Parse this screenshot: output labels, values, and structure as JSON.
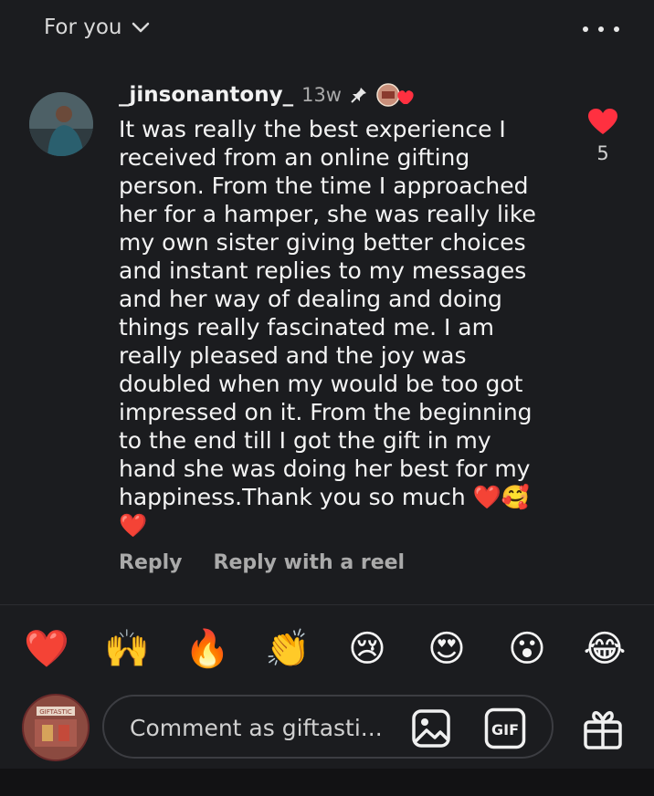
{
  "header": {
    "feed_label": "For you",
    "feed_chevron_icon": "chevron-down-icon",
    "more_icon": "more-horizontal-icon"
  },
  "comment": {
    "username": "_jinsonantony_",
    "age": "13w",
    "pinned_icon": "pin-icon",
    "creator_badge_icon": "liked-by-creator-icon",
    "text": "It was really the best experience I\nreceived from an online gifting\nperson. From the time I approached\nher for a hamper, she was really like\nmy own sister giving better choices\nand instant replies to my messages\nand her way of dealing and doing\nthings really fascinated me. I am\nreally pleased and the joy was\ndoubled when my would be too got\nimpressed on it. From the beginning\nto the end till I got the gift in my\nhand she was doing her best for my\nhappiness.Thank you so much ❤️🥰\n❤️",
    "like_icon": "heart-filled-icon",
    "like_count": "5",
    "reply_label": "Reply",
    "reply_reel_label": "Reply with a reel"
  },
  "quick_reactions": [
    "❤️",
    "🙌",
    "🔥",
    "👏",
    "😢",
    "😍",
    "😮",
    "😂"
  ],
  "composer": {
    "placeholder": "Comment as giftasti...",
    "avatar_text": "GIFTASTIC",
    "image_icon": "image-icon",
    "gif_label": "GIF",
    "gift_icon": "gift-icon"
  },
  "colors": {
    "background": "#1b1c1f",
    "like_red": "#ff3040",
    "secondary_text": "#aaaaaa"
  }
}
